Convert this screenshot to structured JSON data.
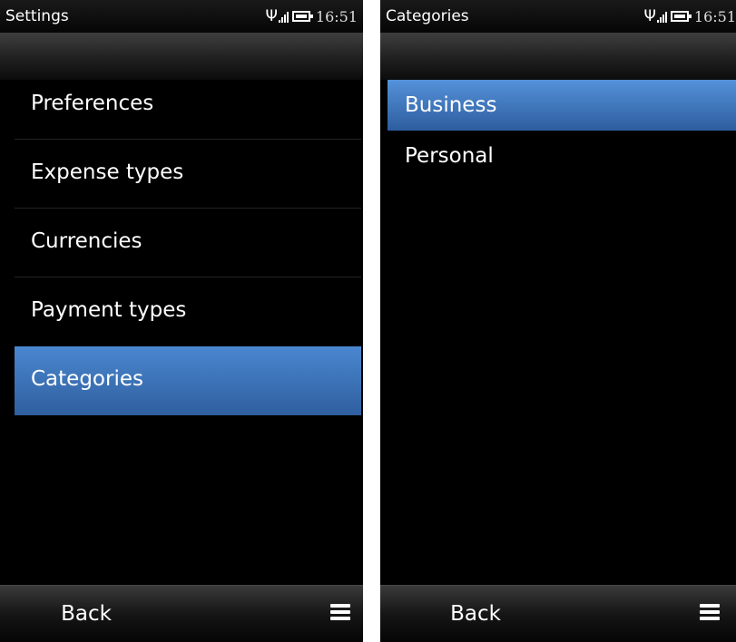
{
  "left_screen": {
    "status": {
      "title": "Settings",
      "time": "16:51",
      "antenna_icon": "antenna-icon",
      "signal_icon": "signal-bars-icon",
      "battery_icon": "battery-icon"
    },
    "menu_items": [
      {
        "label": "Preferences",
        "selected": false
      },
      {
        "label": "Expense types",
        "selected": false
      },
      {
        "label": "Currencies",
        "selected": false
      },
      {
        "label": "Payment types",
        "selected": false
      },
      {
        "label": "Categories",
        "selected": true
      }
    ],
    "softkeys": {
      "back_label": "Back",
      "menu_icon": "menu-icon"
    }
  },
  "right_screen": {
    "status": {
      "title": "Categories",
      "time": "16:51",
      "antenna_icon": "antenna-icon",
      "signal_icon": "signal-bars-icon",
      "battery_icon": "battery-icon"
    },
    "category_items": [
      {
        "label": "Business",
        "selected": true
      },
      {
        "label": "Personal",
        "selected": false
      }
    ],
    "softkeys": {
      "back_label": "Back",
      "menu_icon": "menu-icon"
    }
  },
  "colors": {
    "selection": "#3f75b9",
    "background": "#000000",
    "text": "#ffffff"
  }
}
